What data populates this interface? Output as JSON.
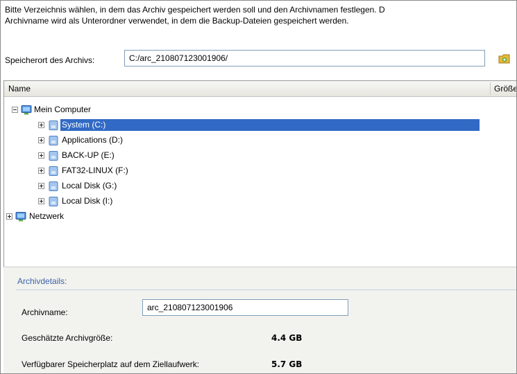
{
  "instructions": {
    "line1": "Bitte Verzeichnis wählen, in dem das Archiv gespeichert werden soll und den Archivnamen festlegen. D",
    "line2": "Archivname wird als Unterordner verwendet, in dem die Backup-Dateien gespeichert werden."
  },
  "location": {
    "label": "Speicherort des Archivs:",
    "value": "C:/arc_210807123001906/",
    "new_folder_icon": "folder-new-icon"
  },
  "tree": {
    "columns": {
      "name": "Name",
      "size": "Größe"
    },
    "nodes": [
      {
        "label": "Mein Computer",
        "icon": "computer-icon",
        "expander": "minus"
      },
      {
        "label": "System (C:)",
        "icon": "drive-icon",
        "expander": "plus",
        "selected": true
      },
      {
        "label": "Applications (D:)",
        "icon": "drive-icon",
        "expander": "plus"
      },
      {
        "label": "BACK-UP (E:)",
        "icon": "drive-icon",
        "expander": "plus"
      },
      {
        "label": "FAT32-LINUX (F:)",
        "icon": "drive-icon",
        "expander": "plus"
      },
      {
        "label": "Local Disk (G:)",
        "icon": "drive-icon",
        "expander": "plus"
      },
      {
        "label": "Local Disk (I:)",
        "icon": "drive-icon",
        "expander": "plus"
      },
      {
        "label": "Netzwerk",
        "icon": "network-icon",
        "expander": "plus"
      }
    ]
  },
  "details": {
    "header": "Archivdetails:",
    "archive_name_label": "Archivname:",
    "archive_name_value": "arc_210807123001906",
    "estimated_size_label": "Geschätzte Archivgröße:",
    "estimated_size_value": "4.4 GB",
    "free_space_label": "Verfügbarer Speicherplatz auf dem Ziellaufwerk:",
    "free_space_value": "5.7 GB"
  },
  "colors": {
    "selection": "#316ac5",
    "details_header": "#3b63a8",
    "details_bg": "#f2f2ef"
  }
}
